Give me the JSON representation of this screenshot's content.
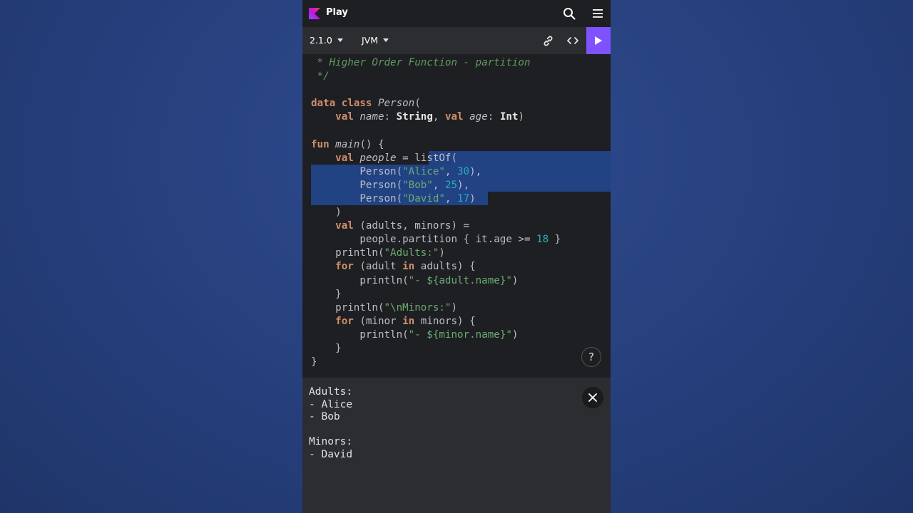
{
  "header": {
    "title": "Play",
    "logo_icon": "kotlin-logo-icon",
    "search_icon": "search-icon",
    "menu_icon": "hamburger-menu-icon"
  },
  "toolbar": {
    "version": "2.1.0",
    "platform": "JVM",
    "link_icon": "link-icon",
    "code_icon": "code-brackets-icon",
    "run_icon": "play-icon"
  },
  "editor": {
    "lines": [
      " * Higher Order Function - partition",
      " */",
      "",
      "data class Person(",
      "    val name: String, val age: Int)",
      "",
      "fun main() {",
      "    val people = listOf(",
      "        Person(\"Alice\", 30),",
      "        Person(\"Bob\", 25),",
      "        Person(\"David\", 17)",
      "    )",
      "    val (adults, minors) =",
      "        people.partition { it.age >= 18 }",
      "    println(\"Adults:\")",
      "    for (adult in adults) {",
      "        println(\"- ${adult.name}\")",
      "    }",
      "    println(\"\\nMinors:\")",
      "    for (minor in minors) {",
      "        println(\"- ${minor.name}\")",
      "    }",
      "}"
    ],
    "help_label": "?"
  },
  "output": {
    "text": "Adults:\n- Alice\n- Bob\n\nMinors:\n- David",
    "close_icon": "close-icon"
  },
  "colors": {
    "accent": "#7f52ff",
    "keyword": "#cf8e6d",
    "string": "#6aab73",
    "number": "#2aacb8",
    "comment": "#5f9b5f",
    "selection": "#214283"
  }
}
